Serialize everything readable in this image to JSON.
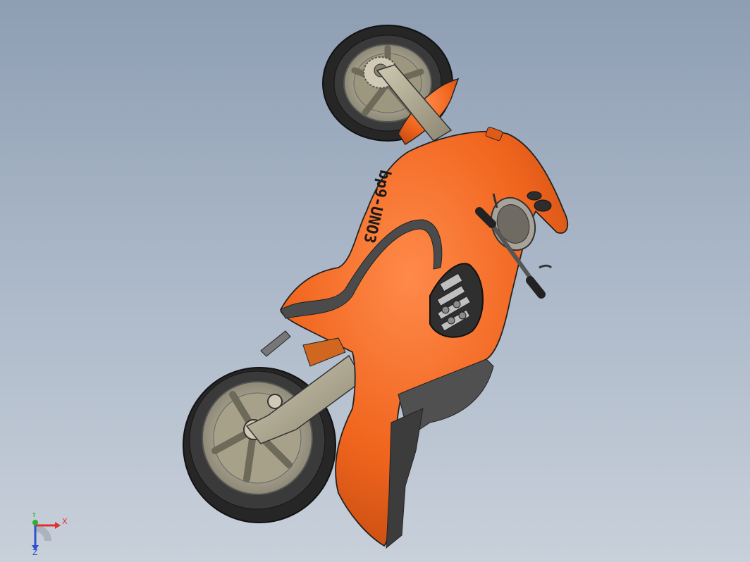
{
  "viewport": {
    "background_top": "#8e9eb3",
    "background_bottom": "#c8d0da"
  },
  "model": {
    "decal_text": "bp9-UNO3",
    "body_color": "#f0651e",
    "body_shadow_color": "#c74a10",
    "trim_color": "#5a5a5a",
    "tire_color": "#2e2e2e",
    "rim_color": "#b9b39e"
  },
  "triad": {
    "x_label": "X",
    "y_label": "Y",
    "z_label": "Z",
    "x_color": "#e03030",
    "y_color": "#30b030",
    "z_color": "#3050d0"
  }
}
